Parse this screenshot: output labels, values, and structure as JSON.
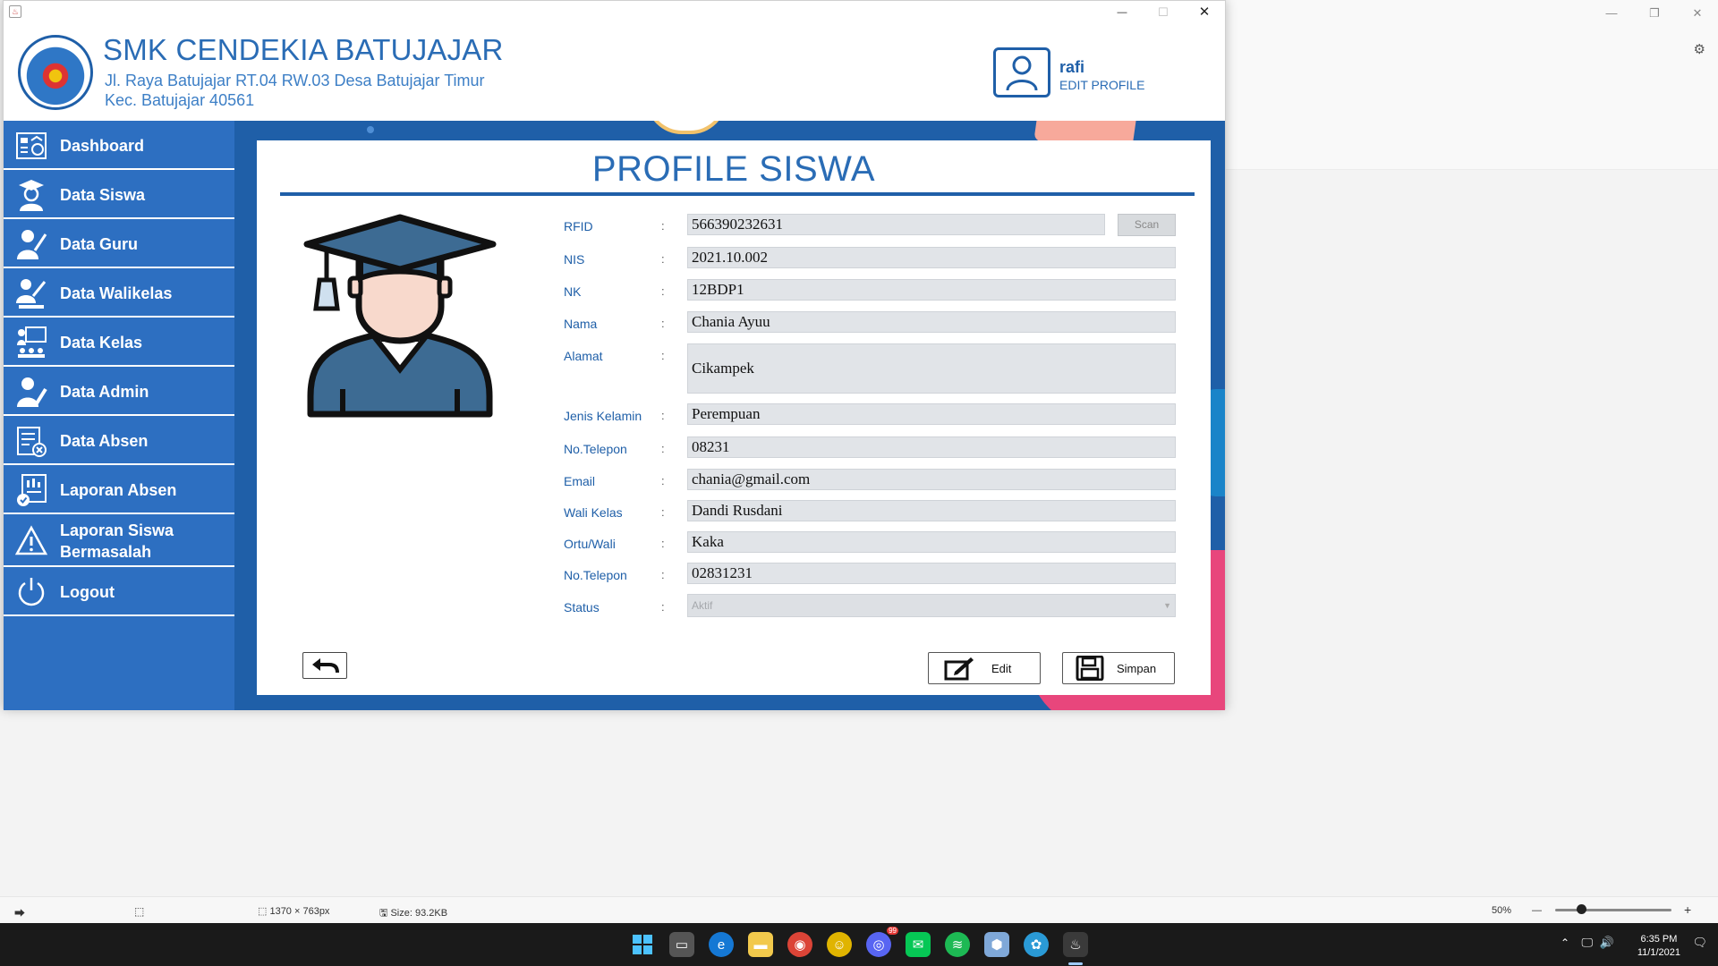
{
  "window": {
    "minimize": "—",
    "maximize": "☐",
    "close": "✕"
  },
  "header": {
    "school_name": "SMK CENDEKIA BATUJAJAR",
    "address_line1": "Jl. Raya Batujajar RT.04 RW.03 Desa Batujajar Timur",
    "address_line2": "Kec. Batujajar 40561",
    "user_name": "rafi",
    "edit_profile": "EDIT PROFILE"
  },
  "sidebar": {
    "items": [
      {
        "label": "Dashboard",
        "icon": "dashboard-icon"
      },
      {
        "label": "Data Siswa",
        "icon": "student-icon"
      },
      {
        "label": "Data Guru",
        "icon": "teacher-icon"
      },
      {
        "label": "Data Walikelas",
        "icon": "homeroom-teacher-icon"
      },
      {
        "label": "Data Kelas",
        "icon": "classroom-icon"
      },
      {
        "label": "Data Admin",
        "icon": "admin-icon"
      },
      {
        "label": "Data Absen",
        "icon": "attendance-icon"
      },
      {
        "label": "Laporan Absen",
        "icon": "attendance-report-icon"
      },
      {
        "label": "Laporan Siswa\nBermasalah",
        "icon": "warning-icon"
      },
      {
        "label": "Logout",
        "icon": "power-icon"
      }
    ]
  },
  "profile": {
    "title": "PROFILE SISWA",
    "colon": ":",
    "fields": {
      "rfid": {
        "label": "RFID",
        "value": "566390232631"
      },
      "nis": {
        "label": "NIS",
        "value": "2021.10.002"
      },
      "nk": {
        "label": "NK",
        "value": "12BDP1"
      },
      "nama": {
        "label": "Nama",
        "value": "Chania Ayuu"
      },
      "alamat": {
        "label": "Alamat",
        "value": "Cikampek"
      },
      "jenis_kelamin": {
        "label": "Jenis Kelamin",
        "value": "Perempuan"
      },
      "telepon": {
        "label": "No.Telepon",
        "value": "08231"
      },
      "email": {
        "label": "Email",
        "value": "chania@gmail.com"
      },
      "wali_kelas": {
        "label": "Wali Kelas",
        "value": "Dandi Rusdani"
      },
      "ortu_wali": {
        "label": "Ortu/Wali",
        "value": "Kaka"
      },
      "telepon_ortu": {
        "label": "No.Telepon",
        "value": "02831231"
      },
      "status": {
        "label": "Status",
        "value": "Aktif"
      }
    },
    "scan_label": "Scan",
    "edit_label": "Edit",
    "simpan_label": "Simpan"
  },
  "viewer": {
    "dimensions": "1370 × 763px",
    "size": "Size: 93.2KB",
    "zoom": "50%",
    "zoom_minus": "—",
    "zoom_plus": "+"
  },
  "taskbar": {
    "time": "6:35 PM",
    "date": "11/1/2021",
    "badge": "99"
  },
  "colors": {
    "primary": "#2d6fc1",
    "accent": "#1f5fa8",
    "highlight_pink": "#e8467c"
  }
}
